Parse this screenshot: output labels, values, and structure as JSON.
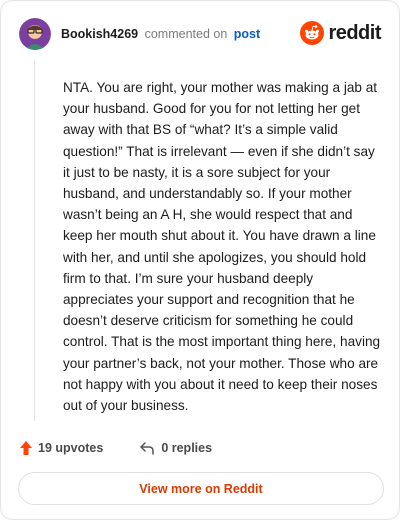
{
  "header": {
    "username": "Bookish4269",
    "verb": "commented on",
    "post_link": "post",
    "brand": "reddit"
  },
  "comment": {
    "text": "NTA. You are right, your mother was making a jab at your husband. Good for you for not letting her get away with that BS of “what? It’s a simple valid question!” That is irrelevant — even if she didn’t say it just to be nasty, it is a sore subject for your husband, and understandably so. If your mother wasn’t being an A H, she would respect that and keep her mouth shut about it. You have drawn a line with her, and until she apologizes, you should hold firm to that. I’m sure your husband deeply appreciates your support and recognition that he doesn’t deserve criticism for something he could control. That is the most important thing here, having your partner’s back, not your mother. Those who are not happy with you about it need to keep their noses out of your business."
  },
  "actions": {
    "upvotes": "19 upvotes",
    "replies": "0 replies"
  },
  "footer": {
    "view_more": "View more on Reddit"
  },
  "colors": {
    "accent": "#d93a00",
    "upvote_arrow": "#ff4500",
    "link": "#0a5cc2",
    "avatar_bg": "#7b3fa0"
  },
  "icons": [
    "avatar",
    "reddit-logo-icon",
    "upvote-arrow-icon",
    "reply-icon"
  ]
}
